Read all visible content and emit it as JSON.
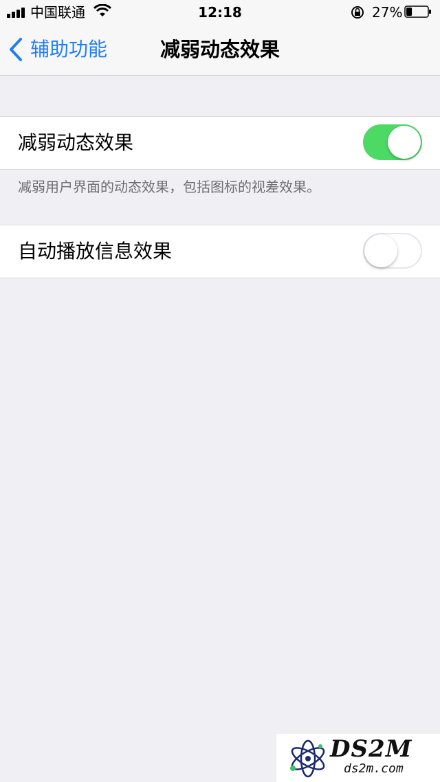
{
  "status_bar": {
    "carrier": "中国联通",
    "time": "12:18",
    "battery_percent": "27%",
    "battery_level": 0.27,
    "icons": [
      "signal-icon",
      "wifi-icon",
      "rotation-lock-icon",
      "battery-icon"
    ]
  },
  "nav": {
    "back_label": "辅助功能",
    "title": "减弱动态效果"
  },
  "settings": [
    {
      "label": "减弱动态效果",
      "enabled": true
    },
    {
      "label": "自动播放信息效果",
      "enabled": false
    }
  ],
  "footnote": "减弱用户界面的动态效果，包括图标的视差效果。",
  "watermark": {
    "brand": "DS2M",
    "domain": "ds2m.com"
  },
  "colors": {
    "accent": "#1e7ef8",
    "toggle_on": "#4cd964",
    "background": "#efeff4"
  }
}
